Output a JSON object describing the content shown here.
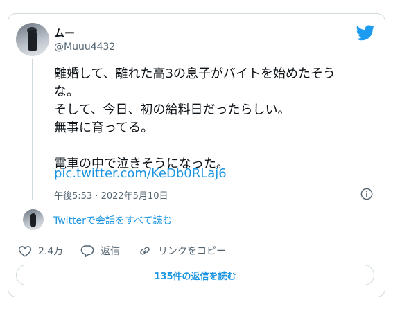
{
  "tweet": {
    "display_name": "ムー",
    "handle": "@Muuu4432",
    "text": "離婚して、離れた高3の息子がバイトを始めたそう\nな。\nそして、今日、初の給料日だったらしい。\n無事に育ってる。\n\n電車の中で泣きそうになった。",
    "link": "pic.twitter.com/KeDb0RLaj6",
    "timestamp": "午後5:53 · 2022年5月10日"
  },
  "conversation_link": "Twitterで会話をすべて読む",
  "actions": {
    "likes": "2.4万",
    "reply": "返信",
    "copy_link": "リンクをコピー"
  },
  "read_replies_button": "135件の返信を読む",
  "colors": {
    "accent": "#1b95e0",
    "twitter_blue": "#1d9bf0",
    "secondary_text": "#536471",
    "border": "#cfd9de"
  },
  "icons": [
    "twitter-bird-icon",
    "info-icon",
    "heart-icon",
    "reply-icon",
    "link-icon"
  ]
}
